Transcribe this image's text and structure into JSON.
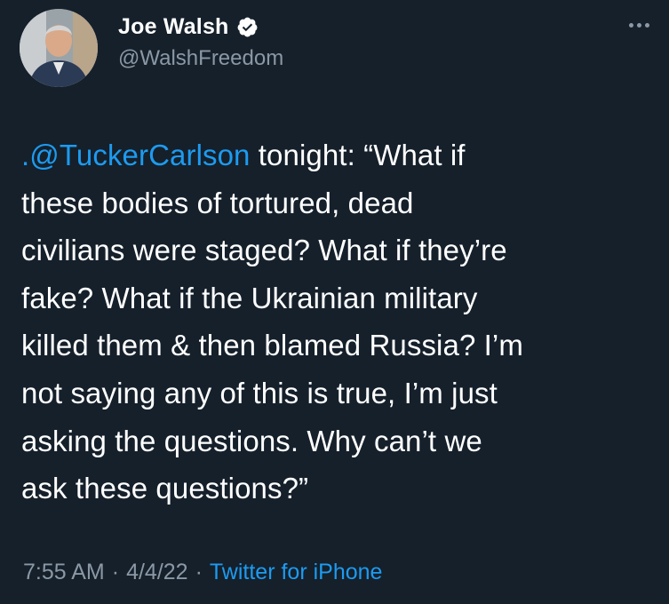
{
  "author": {
    "display_name": "Joe Walsh",
    "handle": "@WalshFreedom",
    "verified": true
  },
  "tweet": {
    "mention": ".@TuckerCarlson",
    "text_line1_rest": " tonight: “What if",
    "text_lines": [
      "these bodies of tortured, dead",
      "civilians were staged? What if they’re",
      "fake? What if the Ukrainian military",
      "killed them & then blamed Russia? I’m",
      "not saying any of this is true, I’m just",
      "asking the questions. Why can’t we",
      "ask these questions?”"
    ]
  },
  "meta": {
    "time": "7:55 AM",
    "separator": "·",
    "date": "4/4/22",
    "source": "Twitter for iPhone"
  },
  "icons": {
    "verified": "verified-badge-icon",
    "more": "more-options-icon"
  },
  "colors": {
    "background": "#15202b",
    "text": "#ffffff",
    "secondary": "#8b98a5",
    "accent": "#1d9bf0"
  }
}
